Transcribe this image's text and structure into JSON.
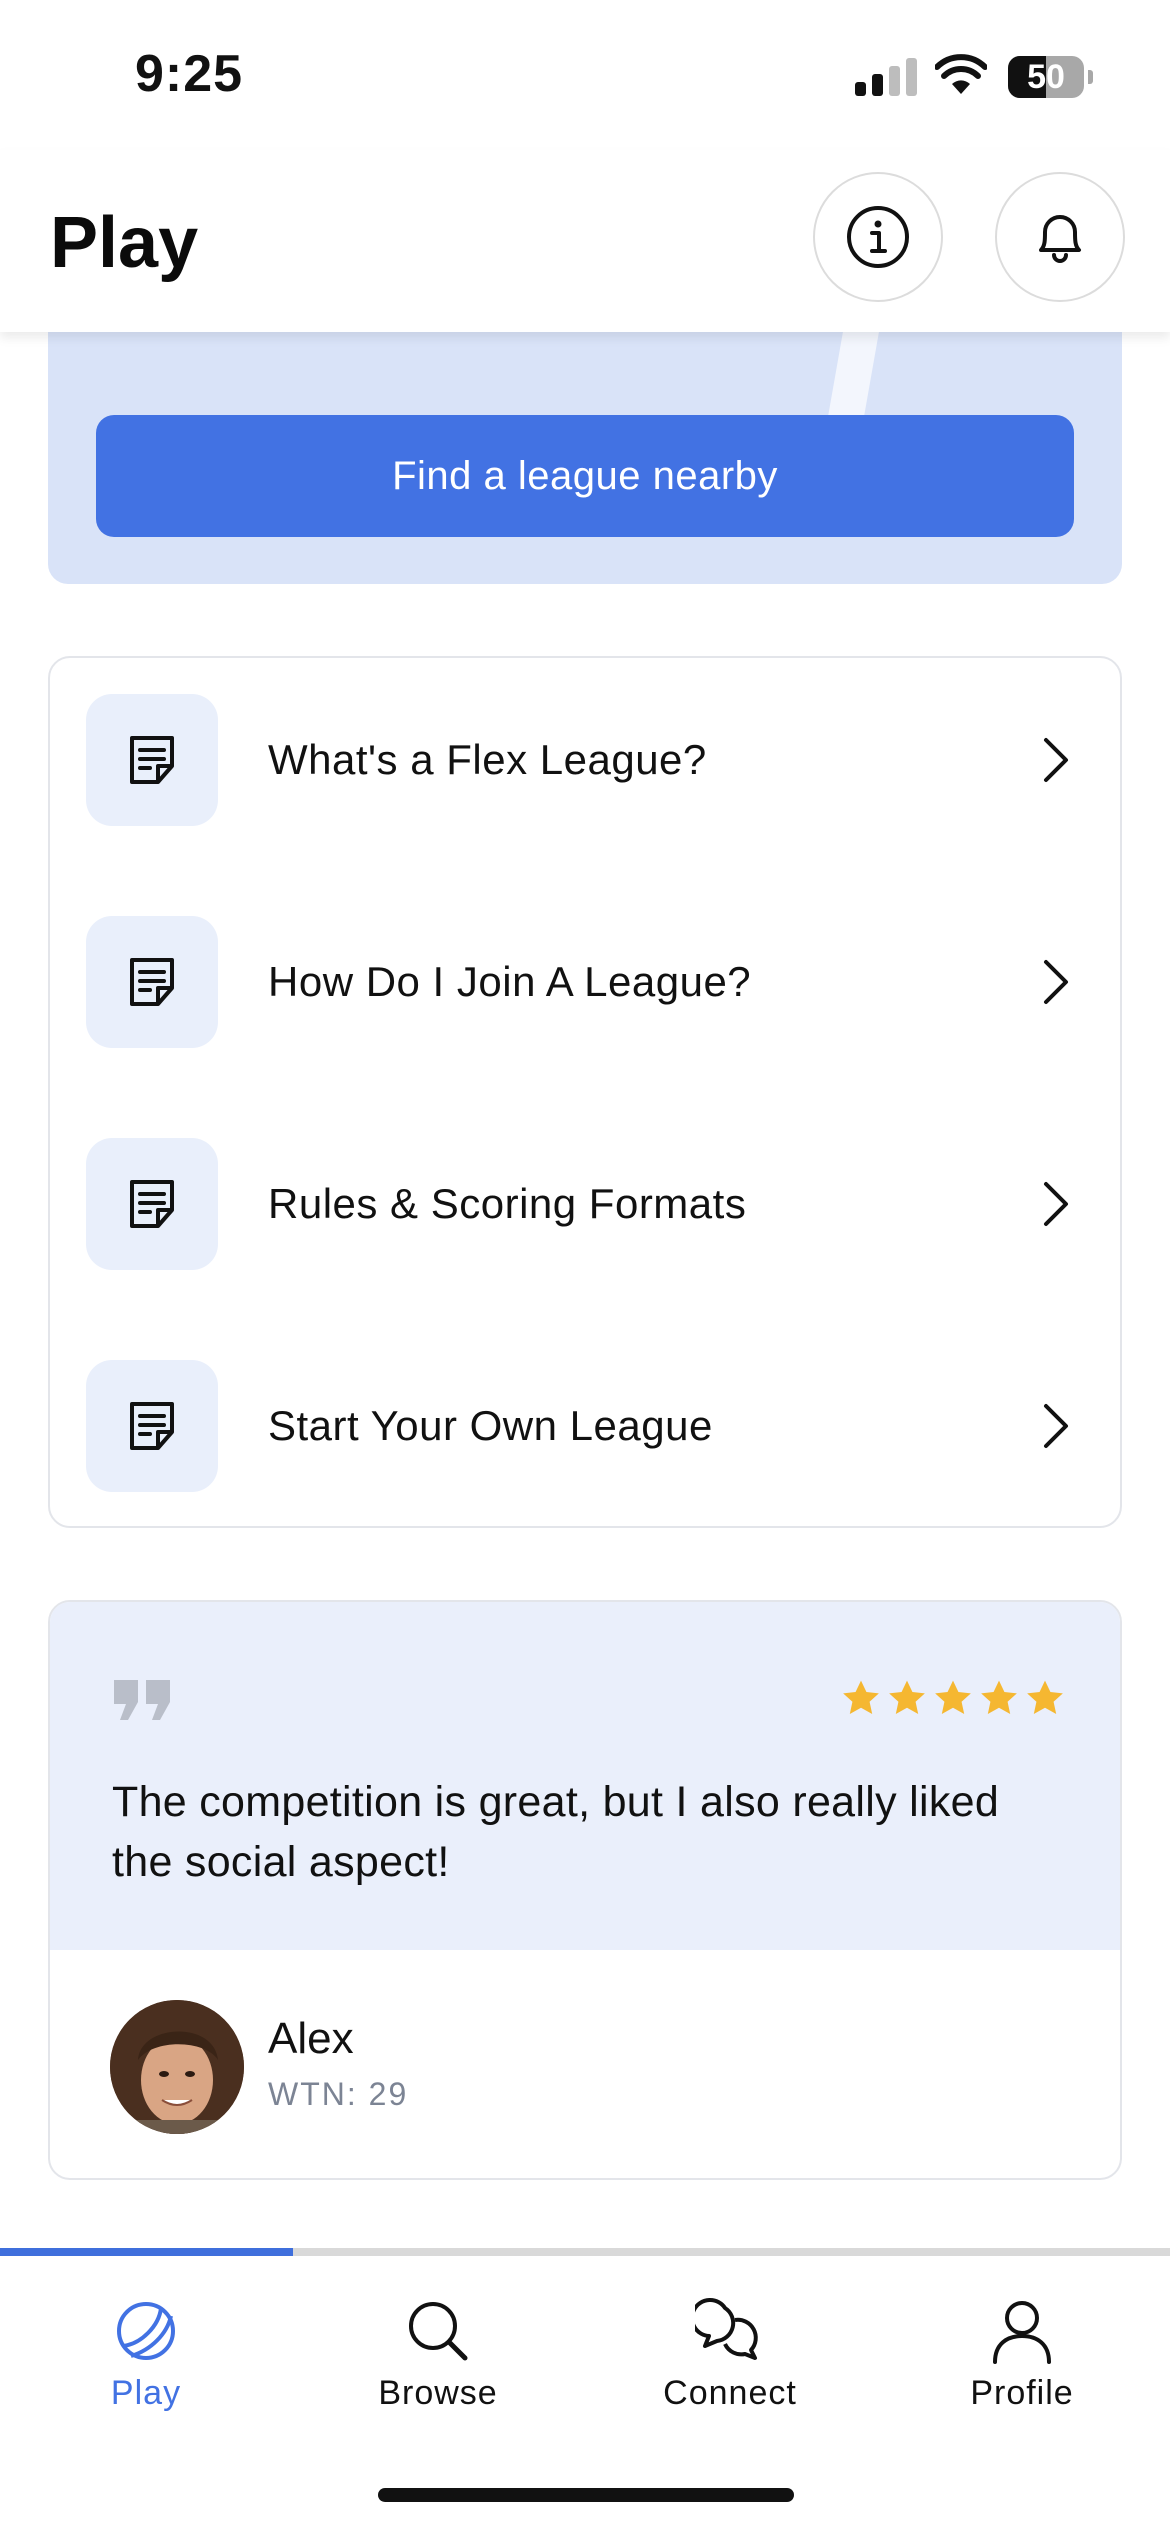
{
  "status_bar": {
    "time": "9:25",
    "battery_level": "50",
    "icons": [
      "cellular-signal-icon",
      "wifi-icon",
      "battery-icon"
    ]
  },
  "header": {
    "title": "Play",
    "actions": [
      {
        "icon": "info-icon"
      },
      {
        "icon": "bell-icon"
      }
    ]
  },
  "promo": {
    "button_label": "Find a league nearby"
  },
  "faq": {
    "items": [
      {
        "label": "What's a Flex League?",
        "icon": "document-icon"
      },
      {
        "label": "How Do I Join A League?",
        "icon": "document-icon"
      },
      {
        "label": "Rules & Scoring Formats",
        "icon": "document-icon"
      },
      {
        "label": "Start Your Own League",
        "icon": "document-icon"
      }
    ]
  },
  "testimonial": {
    "quote": "The competition is great, but I also really liked the social aspect!",
    "rating": 5,
    "rating_max": 5,
    "user": {
      "name": "Alex",
      "meta": "WTN: 29"
    }
  },
  "tab_bar": {
    "progress": 0.25,
    "tabs": [
      {
        "label": "Play",
        "icon": "tennis-ball-icon",
        "active": true
      },
      {
        "label": "Browse",
        "icon": "search-icon",
        "active": false
      },
      {
        "label": "Connect",
        "icon": "chat-bubbles-icon",
        "active": false
      },
      {
        "label": "Profile",
        "icon": "person-icon",
        "active": false
      }
    ]
  },
  "colors": {
    "accent": "#4272e3",
    "promo_bg": "#d9e3f8",
    "icon_tile_bg": "#e9effb",
    "star": "#f5b731"
  }
}
